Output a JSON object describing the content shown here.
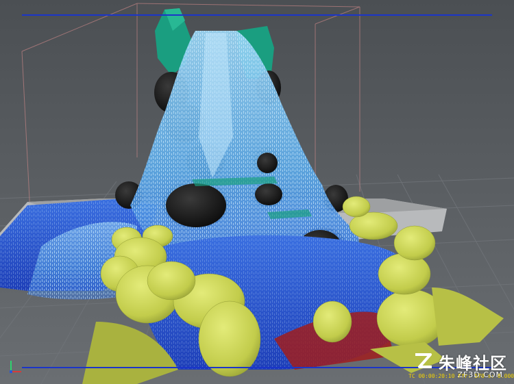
{
  "viewport": {
    "status_readout": "TC 00:00:20:10  Ffr: 570  s: 0.00000",
    "watermark_brand": "朱峰社区",
    "watermark_sub": "ZF3D.COM",
    "watermark_logo_letter": "Z"
  },
  "colors": {
    "background": "#5b5f63",
    "grid": "#6e7277",
    "water_light": "#7ec8f0",
    "water_deep": "#2246c8",
    "rock_dark": "#151515",
    "rock_foreground": "#c5cf4e",
    "green_block": "#1a9e80",
    "ui_line": "#1b35c9"
  }
}
